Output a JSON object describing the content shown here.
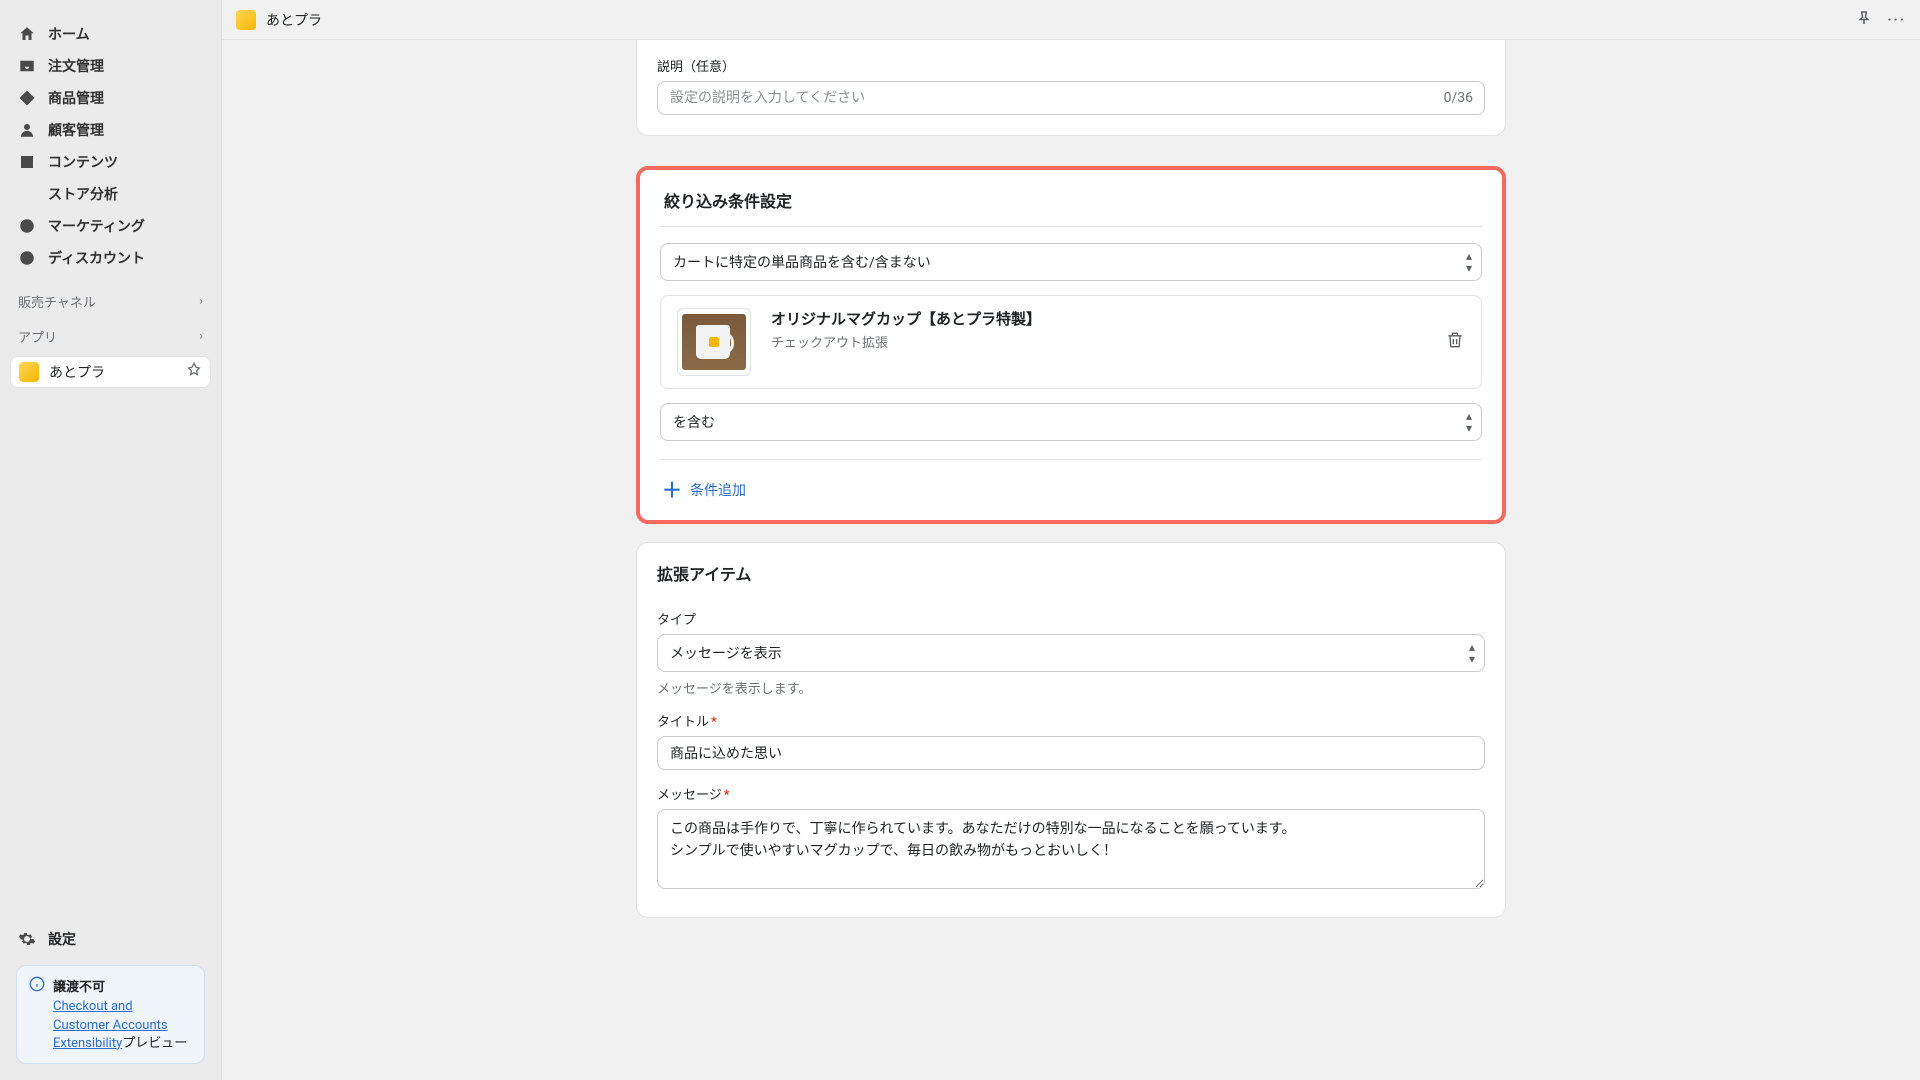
{
  "topbar": {
    "app_name": "あとプラ"
  },
  "nav": {
    "home": "ホーム",
    "orders": "注文管理",
    "products": "商品管理",
    "customers": "顧客管理",
    "content": "コンテンツ",
    "analytics": "ストア分析",
    "marketing": "マーケティング",
    "discounts": "ディスカウント",
    "sales_channels": "販売チャネル",
    "apps": "アプリ",
    "pinned_app": "あとプラ",
    "settings": "設定"
  },
  "info_box": {
    "title": "譲渡不可",
    "link_text": "Checkout and Customer Accounts Extensibility",
    "suffix": "プレビュー"
  },
  "description_section": {
    "label": "説明（任意）",
    "placeholder": "設定の説明を入力してください",
    "counter": "0/36"
  },
  "filter_section": {
    "title": "絞り込み条件設定",
    "condition_select": "カートに特定の単品商品を含む/含まない",
    "product_name": "オリジナルマグカップ【あとプラ特製】",
    "product_sub": "チェックアウト拡張",
    "include_select": "を含む",
    "add_condition": "条件追加"
  },
  "extension_section": {
    "title": "拡張アイテム",
    "type_label": "タイプ",
    "type_value": "メッセージを表示",
    "type_help": "メッセージを表示します。",
    "title_label": "タイトル",
    "title_value": "商品に込めた思い",
    "message_label": "メッセージ",
    "message_value": "この商品は手作りで、丁寧に作られています。あなただけの特別な一品になることを願っています。\nシンプルで使いやすいマグカップで、毎日の飲み物がもっとおいしく！"
  }
}
